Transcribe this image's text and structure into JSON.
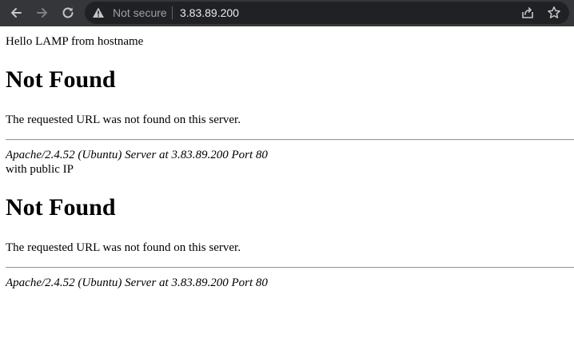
{
  "browser": {
    "security_label": "Not secure",
    "url": "3.83.89.200",
    "colors": {
      "toolbar": "#35363a",
      "omnibox": "#202124",
      "icon": "#c4c7c5"
    },
    "icons": [
      "back-arrow-icon",
      "forward-arrow-icon",
      "reload-icon",
      "warning-icon",
      "share-icon",
      "star-icon"
    ]
  },
  "page": {
    "greeting": "Hello LAMP from hostname",
    "first": {
      "heading": "Not Found",
      "message": "The requested URL was not found on this server.",
      "address": "Apache/2.4.52 (Ubuntu) Server at 3.83.89.200 Port 80"
    },
    "public_ip_note": "with public IP",
    "second": {
      "heading": "Not Found",
      "message": "The requested URL was not found on this server.",
      "address": "Apache/2.4.52 (Ubuntu) Server at 3.83.89.200 Port 80"
    }
  }
}
